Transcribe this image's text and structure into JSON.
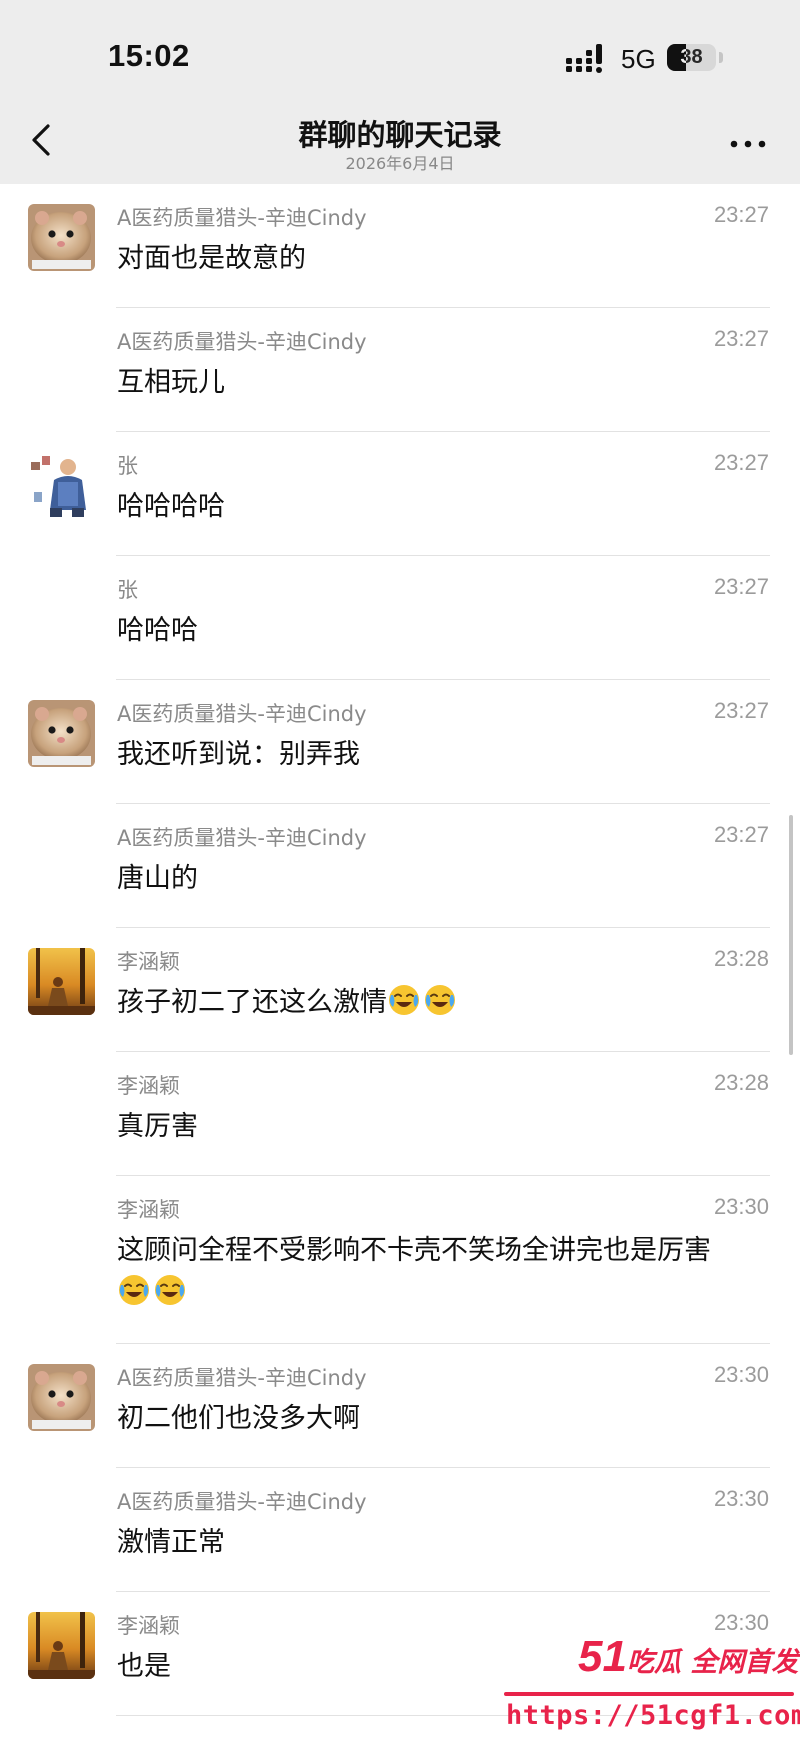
{
  "status_bar": {
    "time": "15:02",
    "network": "5G",
    "battery": "38",
    "battery_percent": 38,
    "signal_icon": "cellular-signal-icon"
  },
  "nav": {
    "title": "群聊的聊天记录",
    "subtitle": "2026年6月4日",
    "back_icon": "chevron-left-icon",
    "more_icon": "more-dots-icon"
  },
  "messages": [
    {
      "sender": "A医药质量猎头-辛迪Cindy",
      "time": "23:27",
      "text": "对面也是故意的",
      "avatar": "hamster-photo"
    },
    {
      "sender": "A医药质量猎头-辛迪Cindy",
      "time": "23:27",
      "text": "互相玩儿"
    },
    {
      "sender": "张",
      "time": "23:27",
      "text": "哈哈哈哈",
      "avatar": "man-photo"
    },
    {
      "sender": "张",
      "time": "23:27",
      "text": "哈哈哈"
    },
    {
      "sender": "A医药质量猎头-辛迪Cindy",
      "time": "23:27",
      "text": "我还听到说：别弄我",
      "avatar": "hamster-photo"
    },
    {
      "sender": "A医药质量猎头-辛迪Cindy",
      "time": "23:27",
      "text": "唐山的"
    },
    {
      "sender": "李涵颖",
      "time": "23:28",
      "text": "孩子初二了还这么激情",
      "emoji_count": 2,
      "avatar": "autumn-forest-photo"
    },
    {
      "sender": "李涵颖",
      "time": "23:28",
      "text": "真厉害"
    },
    {
      "sender": "李涵颖",
      "time": "23:30",
      "text": "这顾问全程不受影响不卡壳不笑场全讲完也是厉害",
      "emoji_count": 2
    },
    {
      "sender": "A医药质量猎头-辛迪Cindy",
      "time": "23:30",
      "text": "初二他们也没多大啊",
      "avatar": "hamster-photo"
    },
    {
      "sender": "A医药质量猎头-辛迪Cindy",
      "time": "23:30",
      "text": "激情正常"
    },
    {
      "sender": "李涵颖",
      "time": "23:30",
      "text": "也是",
      "avatar": "autumn-forest-photo"
    }
  ],
  "emoji_name": "laugh-cry-emoji",
  "watermark": {
    "brand_number": "51",
    "brand_text": "吃瓜 全网首发",
    "url": "https://51cgf1.com"
  },
  "colors": {
    "header_bg": "#ededed",
    "sender": "#8a8a8a",
    "time": "#9b9b9b",
    "watermark": "#e8234a"
  }
}
